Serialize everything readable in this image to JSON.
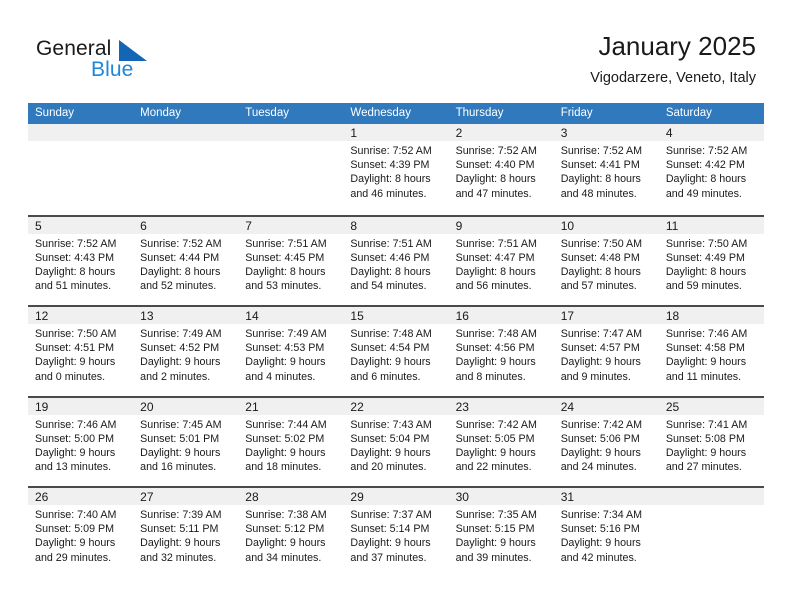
{
  "brand": {
    "word1": "General",
    "word2": "Blue",
    "triangle_color": "#1565b5",
    "blue_color": "#1f86d8"
  },
  "header": {
    "title": "January 2025",
    "location": "Vigodarzere, Veneto, Italy"
  },
  "theme": {
    "header_row_bg": "#3079bd",
    "header_row_text": "#ffffff",
    "daynum_band_bg": "#f0f0f0",
    "row_divider": "#4a4a4a",
    "text": "#1a1a1a"
  },
  "weekdays": [
    "Sunday",
    "Monday",
    "Tuesday",
    "Wednesday",
    "Thursday",
    "Friday",
    "Saturday"
  ],
  "weeks": [
    [
      {
        "day": "",
        "sunrise": "",
        "sunset": "",
        "daylight1": "",
        "daylight2": "",
        "empty": true
      },
      {
        "day": "",
        "sunrise": "",
        "sunset": "",
        "daylight1": "",
        "daylight2": "",
        "empty": true
      },
      {
        "day": "",
        "sunrise": "",
        "sunset": "",
        "daylight1": "",
        "daylight2": "",
        "empty": true
      },
      {
        "day": "1",
        "sunrise": "Sunrise: 7:52 AM",
        "sunset": "Sunset: 4:39 PM",
        "daylight1": "Daylight: 8 hours",
        "daylight2": "and 46 minutes."
      },
      {
        "day": "2",
        "sunrise": "Sunrise: 7:52 AM",
        "sunset": "Sunset: 4:40 PM",
        "daylight1": "Daylight: 8 hours",
        "daylight2": "and 47 minutes."
      },
      {
        "day": "3",
        "sunrise": "Sunrise: 7:52 AM",
        "sunset": "Sunset: 4:41 PM",
        "daylight1": "Daylight: 8 hours",
        "daylight2": "and 48 minutes."
      },
      {
        "day": "4",
        "sunrise": "Sunrise: 7:52 AM",
        "sunset": "Sunset: 4:42 PM",
        "daylight1": "Daylight: 8 hours",
        "daylight2": "and 49 minutes."
      }
    ],
    [
      {
        "day": "5",
        "sunrise": "Sunrise: 7:52 AM",
        "sunset": "Sunset: 4:43 PM",
        "daylight1": "Daylight: 8 hours",
        "daylight2": "and 51 minutes."
      },
      {
        "day": "6",
        "sunrise": "Sunrise: 7:52 AM",
        "sunset": "Sunset: 4:44 PM",
        "daylight1": "Daylight: 8 hours",
        "daylight2": "and 52 minutes."
      },
      {
        "day": "7",
        "sunrise": "Sunrise: 7:51 AM",
        "sunset": "Sunset: 4:45 PM",
        "daylight1": "Daylight: 8 hours",
        "daylight2": "and 53 minutes."
      },
      {
        "day": "8",
        "sunrise": "Sunrise: 7:51 AM",
        "sunset": "Sunset: 4:46 PM",
        "daylight1": "Daylight: 8 hours",
        "daylight2": "and 54 minutes."
      },
      {
        "day": "9",
        "sunrise": "Sunrise: 7:51 AM",
        "sunset": "Sunset: 4:47 PM",
        "daylight1": "Daylight: 8 hours",
        "daylight2": "and 56 minutes."
      },
      {
        "day": "10",
        "sunrise": "Sunrise: 7:50 AM",
        "sunset": "Sunset: 4:48 PM",
        "daylight1": "Daylight: 8 hours",
        "daylight2": "and 57 minutes."
      },
      {
        "day": "11",
        "sunrise": "Sunrise: 7:50 AM",
        "sunset": "Sunset: 4:49 PM",
        "daylight1": "Daylight: 8 hours",
        "daylight2": "and 59 minutes."
      }
    ],
    [
      {
        "day": "12",
        "sunrise": "Sunrise: 7:50 AM",
        "sunset": "Sunset: 4:51 PM",
        "daylight1": "Daylight: 9 hours",
        "daylight2": "and 0 minutes."
      },
      {
        "day": "13",
        "sunrise": "Sunrise: 7:49 AM",
        "sunset": "Sunset: 4:52 PM",
        "daylight1": "Daylight: 9 hours",
        "daylight2": "and 2 minutes."
      },
      {
        "day": "14",
        "sunrise": "Sunrise: 7:49 AM",
        "sunset": "Sunset: 4:53 PM",
        "daylight1": "Daylight: 9 hours",
        "daylight2": "and 4 minutes."
      },
      {
        "day": "15",
        "sunrise": "Sunrise: 7:48 AM",
        "sunset": "Sunset: 4:54 PM",
        "daylight1": "Daylight: 9 hours",
        "daylight2": "and 6 minutes."
      },
      {
        "day": "16",
        "sunrise": "Sunrise: 7:48 AM",
        "sunset": "Sunset: 4:56 PM",
        "daylight1": "Daylight: 9 hours",
        "daylight2": "and 8 minutes."
      },
      {
        "day": "17",
        "sunrise": "Sunrise: 7:47 AM",
        "sunset": "Sunset: 4:57 PM",
        "daylight1": "Daylight: 9 hours",
        "daylight2": "and 9 minutes."
      },
      {
        "day": "18",
        "sunrise": "Sunrise: 7:46 AM",
        "sunset": "Sunset: 4:58 PM",
        "daylight1": "Daylight: 9 hours",
        "daylight2": "and 11 minutes."
      }
    ],
    [
      {
        "day": "19",
        "sunrise": "Sunrise: 7:46 AM",
        "sunset": "Sunset: 5:00 PM",
        "daylight1": "Daylight: 9 hours",
        "daylight2": "and 13 minutes."
      },
      {
        "day": "20",
        "sunrise": "Sunrise: 7:45 AM",
        "sunset": "Sunset: 5:01 PM",
        "daylight1": "Daylight: 9 hours",
        "daylight2": "and 16 minutes."
      },
      {
        "day": "21",
        "sunrise": "Sunrise: 7:44 AM",
        "sunset": "Sunset: 5:02 PM",
        "daylight1": "Daylight: 9 hours",
        "daylight2": "and 18 minutes."
      },
      {
        "day": "22",
        "sunrise": "Sunrise: 7:43 AM",
        "sunset": "Sunset: 5:04 PM",
        "daylight1": "Daylight: 9 hours",
        "daylight2": "and 20 minutes."
      },
      {
        "day": "23",
        "sunrise": "Sunrise: 7:42 AM",
        "sunset": "Sunset: 5:05 PM",
        "daylight1": "Daylight: 9 hours",
        "daylight2": "and 22 minutes."
      },
      {
        "day": "24",
        "sunrise": "Sunrise: 7:42 AM",
        "sunset": "Sunset: 5:06 PM",
        "daylight1": "Daylight: 9 hours",
        "daylight2": "and 24 minutes."
      },
      {
        "day": "25",
        "sunrise": "Sunrise: 7:41 AM",
        "sunset": "Sunset: 5:08 PM",
        "daylight1": "Daylight: 9 hours",
        "daylight2": "and 27 minutes."
      }
    ],
    [
      {
        "day": "26",
        "sunrise": "Sunrise: 7:40 AM",
        "sunset": "Sunset: 5:09 PM",
        "daylight1": "Daylight: 9 hours",
        "daylight2": "and 29 minutes."
      },
      {
        "day": "27",
        "sunrise": "Sunrise: 7:39 AM",
        "sunset": "Sunset: 5:11 PM",
        "daylight1": "Daylight: 9 hours",
        "daylight2": "and 32 minutes."
      },
      {
        "day": "28",
        "sunrise": "Sunrise: 7:38 AM",
        "sunset": "Sunset: 5:12 PM",
        "daylight1": "Daylight: 9 hours",
        "daylight2": "and 34 minutes."
      },
      {
        "day": "29",
        "sunrise": "Sunrise: 7:37 AM",
        "sunset": "Sunset: 5:14 PM",
        "daylight1": "Daylight: 9 hours",
        "daylight2": "and 37 minutes."
      },
      {
        "day": "30",
        "sunrise": "Sunrise: 7:35 AM",
        "sunset": "Sunset: 5:15 PM",
        "daylight1": "Daylight: 9 hours",
        "daylight2": "and 39 minutes."
      },
      {
        "day": "31",
        "sunrise": "Sunrise: 7:34 AM",
        "sunset": "Sunset: 5:16 PM",
        "daylight1": "Daylight: 9 hours",
        "daylight2": "and 42 minutes."
      },
      {
        "day": "",
        "sunrise": "",
        "sunset": "",
        "daylight1": "",
        "daylight2": "",
        "empty": true
      }
    ]
  ]
}
